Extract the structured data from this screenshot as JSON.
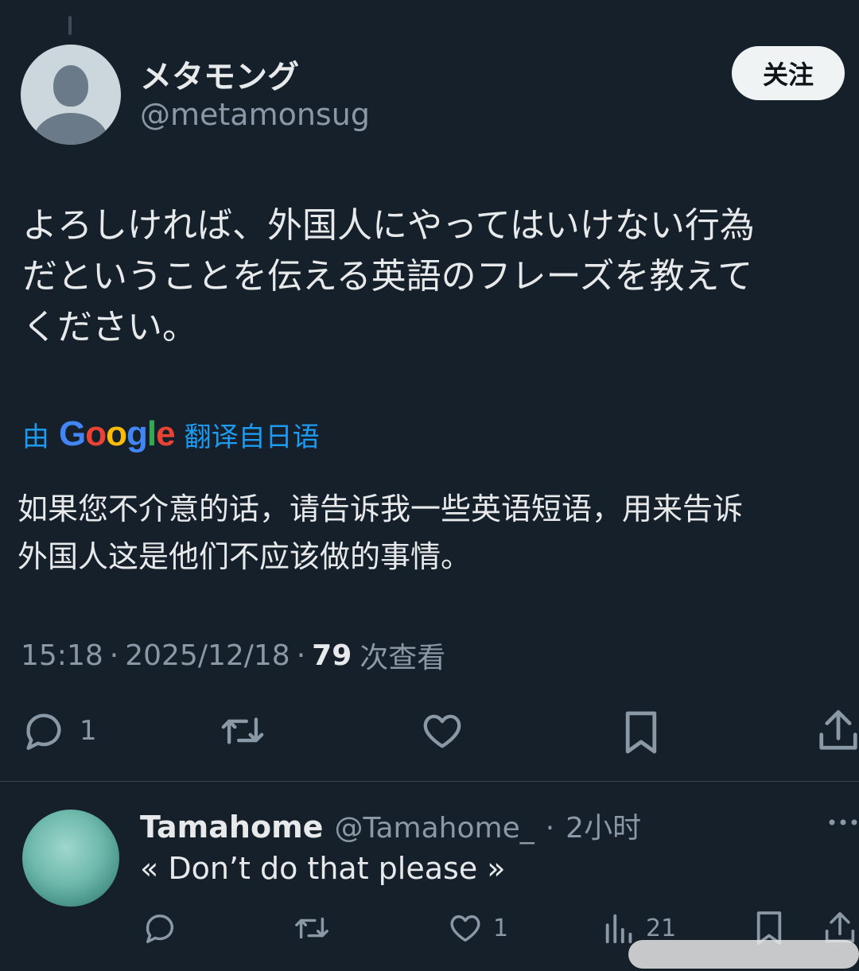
{
  "author": {
    "display_name": "メタモング",
    "handle": "@metamonsug",
    "follow_label": "关注"
  },
  "tweet": {
    "text": "よろしければ、外国人にやってはいけない行為\nだということを伝える英語のフレーズを教えて\nください。",
    "translation_prefix": "由",
    "translation_brand": "Google",
    "translation_suffix": "翻译自日语",
    "translated_text": "如果您不介意的话，请告诉我一些英语短语，用来告诉\n外国人这是他们不应该做的事情。",
    "time": "15:18",
    "date": "2025/12/18",
    "views_count": "79",
    "views_label": "次查看"
  },
  "actions": {
    "reply_count": "1",
    "retweet_count": "",
    "like_count": "",
    "bookmark_count": ""
  },
  "reply": {
    "display_name": "Tamahome",
    "handle": "@Tamahome_",
    "separator": "·",
    "time": "2小时",
    "text": "« Don’t do that please »",
    "like_count": "1",
    "views_count": "21"
  },
  "colors": {
    "background": "#15202b",
    "text_primary": "#e7e9ea",
    "text_secondary": "#8b98a5",
    "accent": "#1d9bf0"
  }
}
